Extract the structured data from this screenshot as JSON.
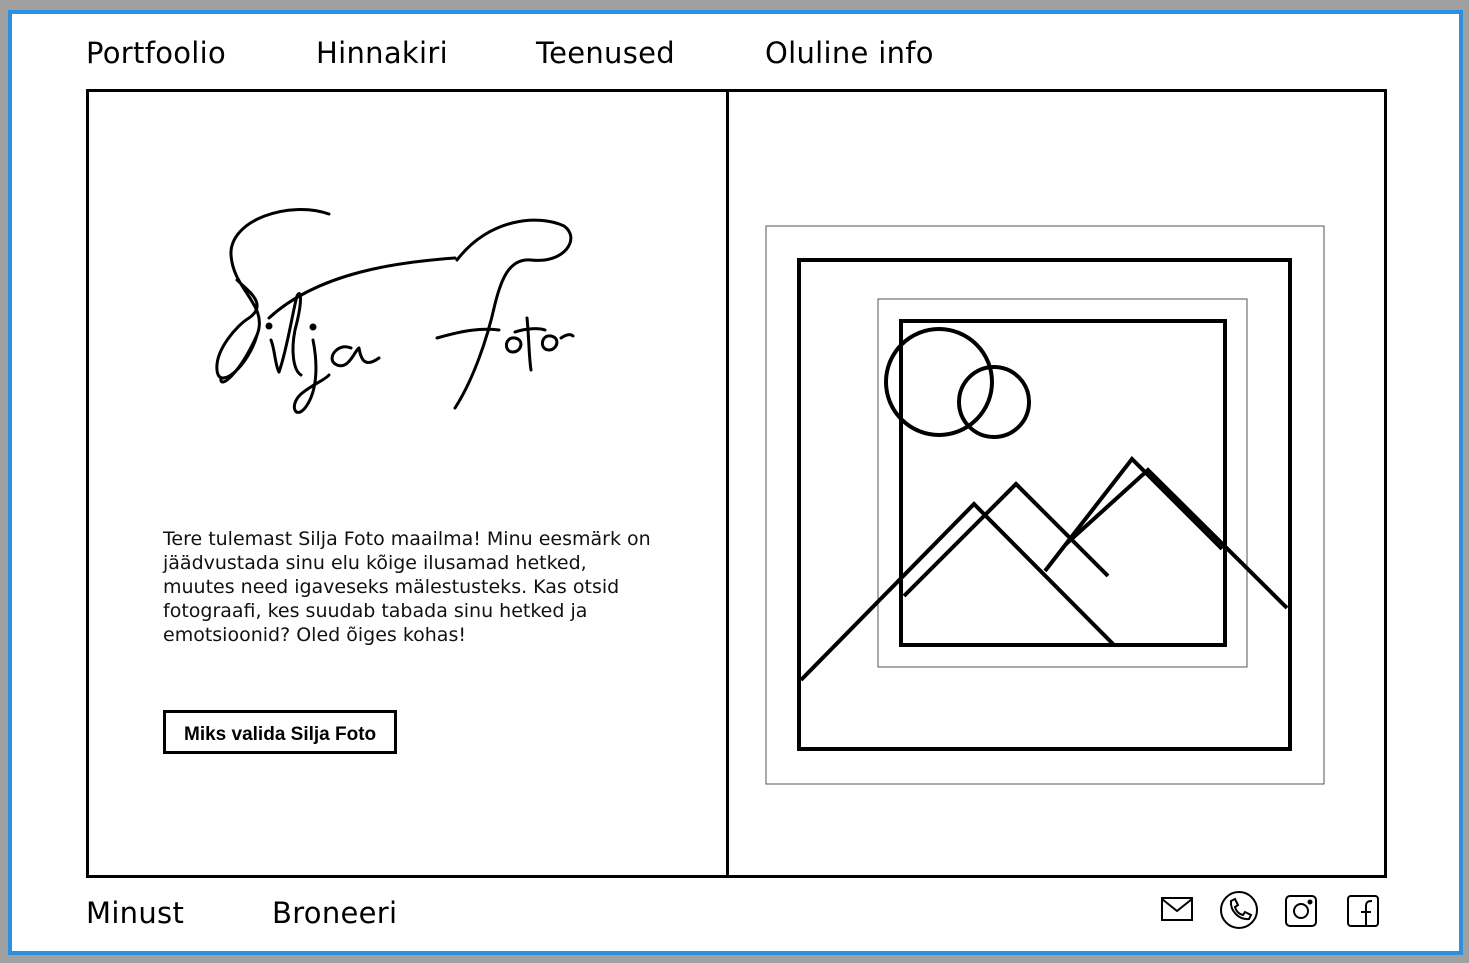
{
  "header": {
    "nav": [
      {
        "label": "Portfoolio"
      },
      {
        "label": "Hinnakiri"
      },
      {
        "label": "Teenused"
      },
      {
        "label": "Oluline info"
      }
    ]
  },
  "hero": {
    "logo_text": "Silja Foto",
    "welcome_text": "Tere tulemast Silja Foto maailma! Minu eesmärk on jäädvustada sinu elu kõige ilusamad hetked, muutes need igaveseks mälestusteks. Kas otsid fotograafi, kes suudab tabada sinu hetked ja emotsioonid? Oled õiges kohas!",
    "cta_label": "Miks valida Silja Foto",
    "image_placeholder": "image-placeholder-icon"
  },
  "footer": {
    "nav": [
      {
        "label": "Minust"
      },
      {
        "label": "Broneeri"
      }
    ],
    "social_icons": [
      "mail-icon",
      "phone-icon",
      "instagram-icon",
      "facebook-icon"
    ]
  },
  "colors": {
    "frame_border": "#2d8fe0",
    "background": "#ffffff",
    "stroke": "#000000"
  }
}
